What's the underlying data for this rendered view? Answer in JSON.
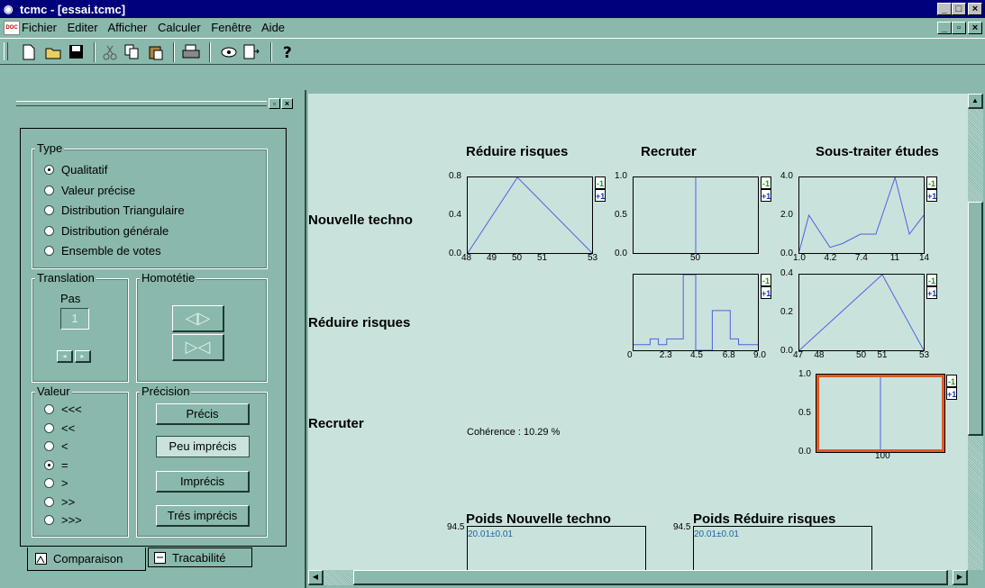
{
  "window": {
    "title": "tcmc - [essai.tcmc]",
    "min": "_",
    "max": "□",
    "close": "×",
    "inner_min": "_",
    "inner_restore": "▫",
    "inner_close": "×"
  },
  "menu": [
    "Fichier",
    "Editer",
    "Afficher",
    "Calculer",
    "Fenêtre",
    "Aide"
  ],
  "doc_icon": "DOC",
  "toolbar_icons": [
    "new-icon",
    "open-icon",
    "save-icon",
    "cut-icon",
    "copy-icon",
    "paste-icon",
    "print-icon",
    "view-icon",
    "export-icon",
    "help-icon"
  ],
  "panel": {
    "type_label": "Type",
    "type_options": [
      "Qualitatif",
      "Valeur précise",
      "Distribution Triangulaire",
      "Distribution générale",
      "Ensemble de votes"
    ],
    "type_selected": 0,
    "translation_label": "Translation",
    "pas_label": "Pas",
    "pas_value": "1",
    "homotetie_label": "Homotétie",
    "valeur_label": "Valeur",
    "valeur_options": [
      "<<<",
      "<<",
      "<",
      "=",
      ">",
      ">>",
      ">>>"
    ],
    "valeur_selected": 3,
    "precision_label": "Précision",
    "precision_buttons": [
      "Précis",
      "Peu imprécis",
      "Imprécis",
      "Trés imprécis"
    ],
    "tabs": [
      "Comparaison",
      "Tracabilité"
    ]
  },
  "matrix": {
    "col_titles": [
      "Réduire risques",
      "Recruter",
      "Sous-traiter études"
    ],
    "row_labels": [
      "Nouvelle techno",
      "Réduire risques",
      "Recruter"
    ],
    "coherence": "Cohérence : 10.29 %",
    "minus": "-1",
    "plus": "+1"
  },
  "charts": {
    "c11": {
      "y": [
        "0.8",
        "0.4",
        "0.0"
      ],
      "x": [
        "48",
        "49",
        "50",
        "51",
        "53"
      ]
    },
    "c12": {
      "y": [
        "1.0",
        "0.5",
        "0.0"
      ],
      "x": [
        "50"
      ]
    },
    "c13": {
      "y": [
        "4.0",
        "2.0",
        "0.0"
      ],
      "x": [
        "1.0",
        "4.2",
        "7.4",
        "11",
        "14"
      ]
    },
    "c22": {
      "x": [
        "0",
        "2.3",
        "4.5",
        "6.8",
        "9.0"
      ]
    },
    "c23": {
      "y": [
        "0.4",
        "0.2",
        "0.0"
      ],
      "x": [
        "47",
        "48",
        "50",
        "51",
        "53"
      ]
    },
    "c33": {
      "y": [
        "1.0",
        "0.5",
        "0.0"
      ],
      "x": [
        "100"
      ]
    }
  },
  "weights": [
    {
      "title": "Poids Nouvelle techno",
      "y": "94.5",
      "value": "20.01±0.01"
    },
    {
      "title": "Poids Réduire risques",
      "y": "94.5",
      "value": "20.01±0.01"
    }
  ],
  "chart_data": [
    {
      "type": "line",
      "x": [
        48,
        50,
        53
      ],
      "y": [
        0.0,
        0.8,
        0.0
      ],
      "ylim": [
        0,
        0.8
      ]
    },
    {
      "type": "line",
      "x": [
        50,
        50
      ],
      "y": [
        0,
        1.0
      ],
      "ylim": [
        0,
        1.0
      ]
    },
    {
      "type": "line",
      "x": [
        1.0,
        2.0,
        4.2,
        5.5,
        7.4,
        9.0,
        11,
        12.5,
        14
      ],
      "y": [
        0.1,
        2.0,
        0.3,
        0.5,
        1.0,
        1.0,
        4.0,
        1.0,
        2.0
      ],
      "ylim": [
        0,
        4.0
      ]
    },
    {
      "type": "line",
      "x": [
        0,
        0.6,
        1.2,
        1.2,
        1.8,
        1.8,
        2.4,
        2.4,
        3.0,
        3.0,
        3.6,
        3.6,
        4.2,
        4.2,
        4.5,
        4.5,
        5.1,
        5.1,
        5.7,
        5.7,
        6.3,
        6.3,
        7.0,
        7.0,
        7.6,
        7.6,
        9.0
      ],
      "y": [
        0.03,
        0.03,
        0.03,
        0.06,
        0.06,
        0.03,
        0.03,
        0.06,
        0.06,
        0.06,
        0.06,
        0.4,
        0.4,
        0.4,
        0.4,
        0.0,
        0.0,
        0.0,
        0.0,
        0.21,
        0.21,
        0.21,
        0.21,
        0.06,
        0.06,
        0.03,
        0.03
      ],
      "ylim": [
        0,
        0.4
      ]
    },
    {
      "type": "line",
      "x": [
        47,
        51,
        53
      ],
      "y": [
        0.0,
        0.4,
        0.0
      ],
      "ylim": [
        0,
        0.4
      ]
    },
    {
      "type": "line",
      "x": [
        100,
        100
      ],
      "y": [
        0,
        1.0
      ],
      "ylim": [
        0,
        1.0
      ]
    }
  ]
}
